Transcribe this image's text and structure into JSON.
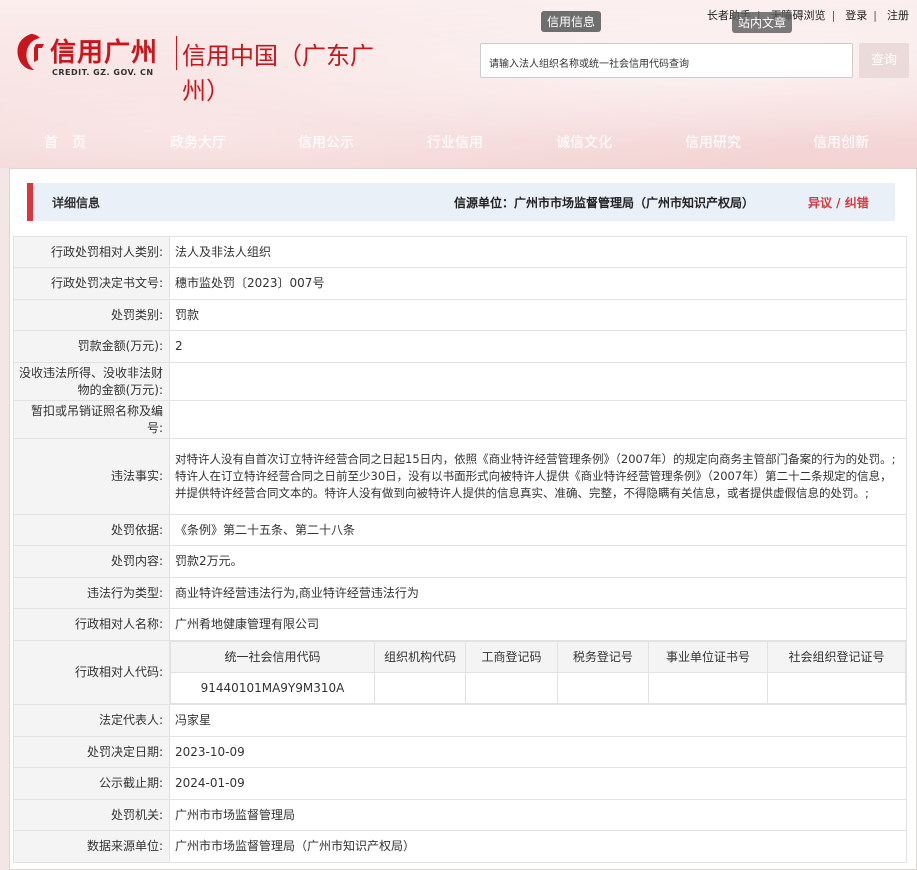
{
  "header": {
    "top_links": [
      "长者助手",
      "无障碍浏览",
      "登录",
      "注册"
    ],
    "tags": [
      "信用信息",
      "站内文章"
    ],
    "logo_cn": "信用广州",
    "logo_en": "CREDIT. GZ. GOV. CN",
    "logo_sub": "信用中国（广东广州）",
    "search_placeholder": "请输入法人组织名称或统一社会信用代码查询",
    "search_button": "查询",
    "nav": [
      "首　页",
      "政务大厅",
      "信用公示",
      "行业信用",
      "诚信文化",
      "信用研究",
      "信用创新"
    ],
    "accent_color": "#c8161d"
  },
  "detail": {
    "title": "详细信息",
    "source": "信源单位：广州市市场监督管理局（广州市知识产权局）",
    "objection": "异议 / 纠错",
    "rows": [
      {
        "k": "行政处罚相对人类别:",
        "v": "法人及非法人组织"
      },
      {
        "k": "行政处罚决定书文号:",
        "v": "穗市监处罚〔2023〕007号"
      },
      {
        "k": "处罚类别:",
        "v": "罚款"
      },
      {
        "k": "罚款金额(万元):",
        "v": "2"
      },
      {
        "k": "没收违法所得、没收非法财物的金额(万元):",
        "v": ""
      },
      {
        "k": "暂扣或吊销证照名称及编号:",
        "v": ""
      },
      {
        "k": "违法事实:",
        "v": "对特许人没有自首次订立特许经营合同之日起15日内，依照《商业特许经营管理条例》（2007年）的规定向商务主管部门备案的行为的处罚。;特许人在订立特许经营合同之日前至少30日，没有以书面形式向被特许人提供《商业特许经营管理条例》（2007年）第二十二条规定的信息，并提供特许经营合同文本的。特许人没有做到向被特许人提供的信息真实、准确、完整，不得隐瞒有关信息，或者提供虚假信息的处罚。;"
      },
      {
        "k": "处罚依据:",
        "v": "《条例》第二十五条、第二十八条"
      },
      {
        "k": "处罚内容:",
        "v": "罚款2万元。"
      },
      {
        "k": "违法行为类型:",
        "v": "商业特许经营违法行为,商业特许经营违法行为"
      },
      {
        "k": "行政相对人名称:",
        "v": "广州肴地健康管理有限公司"
      }
    ],
    "code_label": "行政相对人代码:",
    "code_headers": [
      "统一社会信用代码",
      "组织机构代码",
      "工商登记码",
      "税务登记号",
      "事业单位证书号",
      "社会组织登记证号"
    ],
    "code_values": [
      "91440101MA9Y9M310A",
      "",
      "",
      "",
      "",
      ""
    ],
    "rows2": [
      {
        "k": "法定代表人:",
        "v": "冯家星"
      },
      {
        "k": "处罚决定日期:",
        "v": "2023-10-09"
      },
      {
        "k": "公示截止期:",
        "v": "2024-01-09"
      },
      {
        "k": "处罚机关:",
        "v": "广州市市场监督管理局"
      },
      {
        "k": "数据来源单位:",
        "v": "广州市市场监督管理局（广州市知识产权局）"
      }
    ]
  }
}
